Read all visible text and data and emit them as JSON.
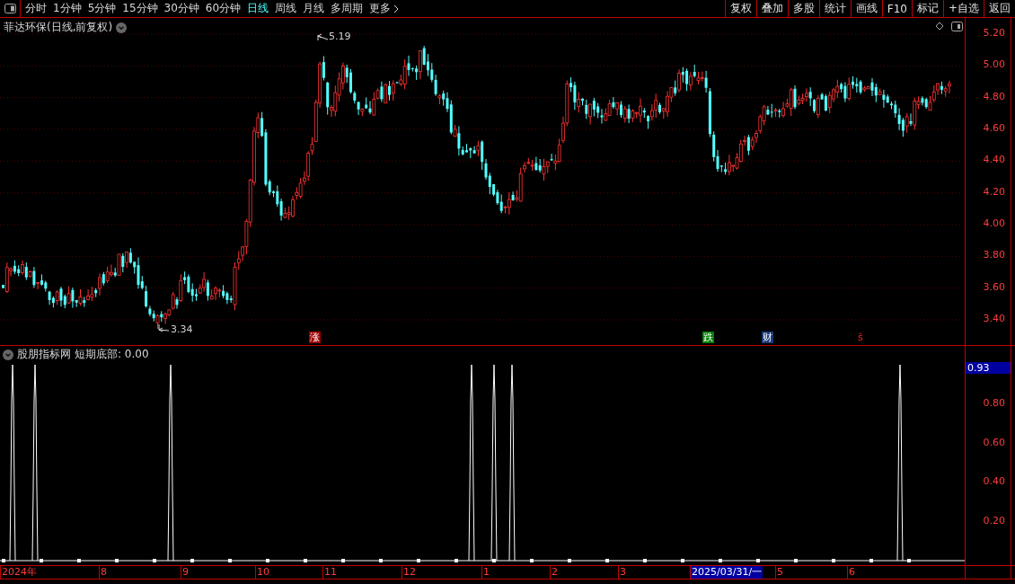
{
  "toolbar": {
    "periods": [
      {
        "label": "分时",
        "selected": false
      },
      {
        "label": "1分钟",
        "selected": false
      },
      {
        "label": "5分钟",
        "selected": false
      },
      {
        "label": "15分钟",
        "selected": false
      },
      {
        "label": "30分钟",
        "selected": false
      },
      {
        "label": "60分钟",
        "selected": false
      },
      {
        "label": "日线",
        "selected": true
      },
      {
        "label": "周线",
        "selected": false
      },
      {
        "label": "月线",
        "selected": false
      },
      {
        "label": "多周期",
        "selected": false
      },
      {
        "label": "更多",
        "selected": false
      }
    ],
    "buttons": [
      "复权",
      "叠加",
      "多股",
      "统计",
      "画线",
      "F10",
      "标记",
      "+自选",
      "返回"
    ]
  },
  "chart": {
    "title": "菲达环保(日线,前复权)",
    "price_ticks": [
      "5.20",
      "5.00",
      "4.80",
      "4.60",
      "4.40",
      "4.20",
      "4.00",
      "3.80",
      "3.60",
      "3.40"
    ],
    "high_label": "5.19",
    "low_label": "3.34",
    "markers": [
      {
        "kind": "rise",
        "label": "涨"
      },
      {
        "kind": "fall",
        "label": "跌"
      },
      {
        "kind": "finance",
        "label": "财"
      },
      {
        "kind": "dividend",
        "label": "ŝ"
      }
    ]
  },
  "indicator": {
    "name": "股朋指标网",
    "reading": "短期底部: 0.00",
    "ticks": [
      "0.80",
      "0.60",
      "0.40",
      "0.20"
    ],
    "cursor_value": "0.93"
  },
  "dates": [
    {
      "label": "2024年",
      "selected": false
    },
    {
      "label": "8",
      "selected": false
    },
    {
      "label": "9",
      "selected": false
    },
    {
      "label": "10",
      "selected": false
    },
    {
      "label": "11",
      "selected": false
    },
    {
      "label": "12",
      "selected": false
    },
    {
      "label": "1",
      "selected": false
    },
    {
      "label": "2",
      "selected": false
    },
    {
      "label": "3",
      "selected": false
    },
    {
      "label": "2025/03/31/一",
      "selected": true
    },
    {
      "label": "5",
      "selected": false
    },
    {
      "label": "6",
      "selected": false
    }
  ]
}
